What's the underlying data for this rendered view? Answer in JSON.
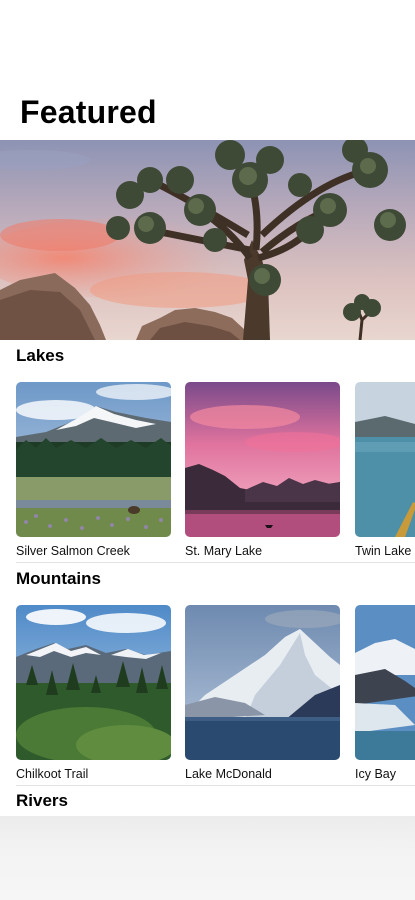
{
  "page": {
    "title": "Featured"
  },
  "hero": {
    "image": "joshua-tree-sunset-photo"
  },
  "sections": [
    {
      "title": "Lakes",
      "items": [
        {
          "label": "Silver Salmon Creek",
          "image": "snowy-mountain-meadow-photo"
        },
        {
          "label": "St. Mary Lake",
          "image": "pink-sunset-lake-photo"
        },
        {
          "label": "Twin Lake",
          "image": "lake-kayak-photo"
        }
      ]
    },
    {
      "title": "Mountains",
      "items": [
        {
          "label": "Chilkoot Trail",
          "image": "forest-mountain-range-photo"
        },
        {
          "label": "Lake McDonald",
          "image": "snow-peak-lake-photo"
        },
        {
          "label": "Icy Bay",
          "image": "glacier-bay-photo"
        }
      ]
    },
    {
      "title": "Rivers",
      "items": []
    }
  ]
}
